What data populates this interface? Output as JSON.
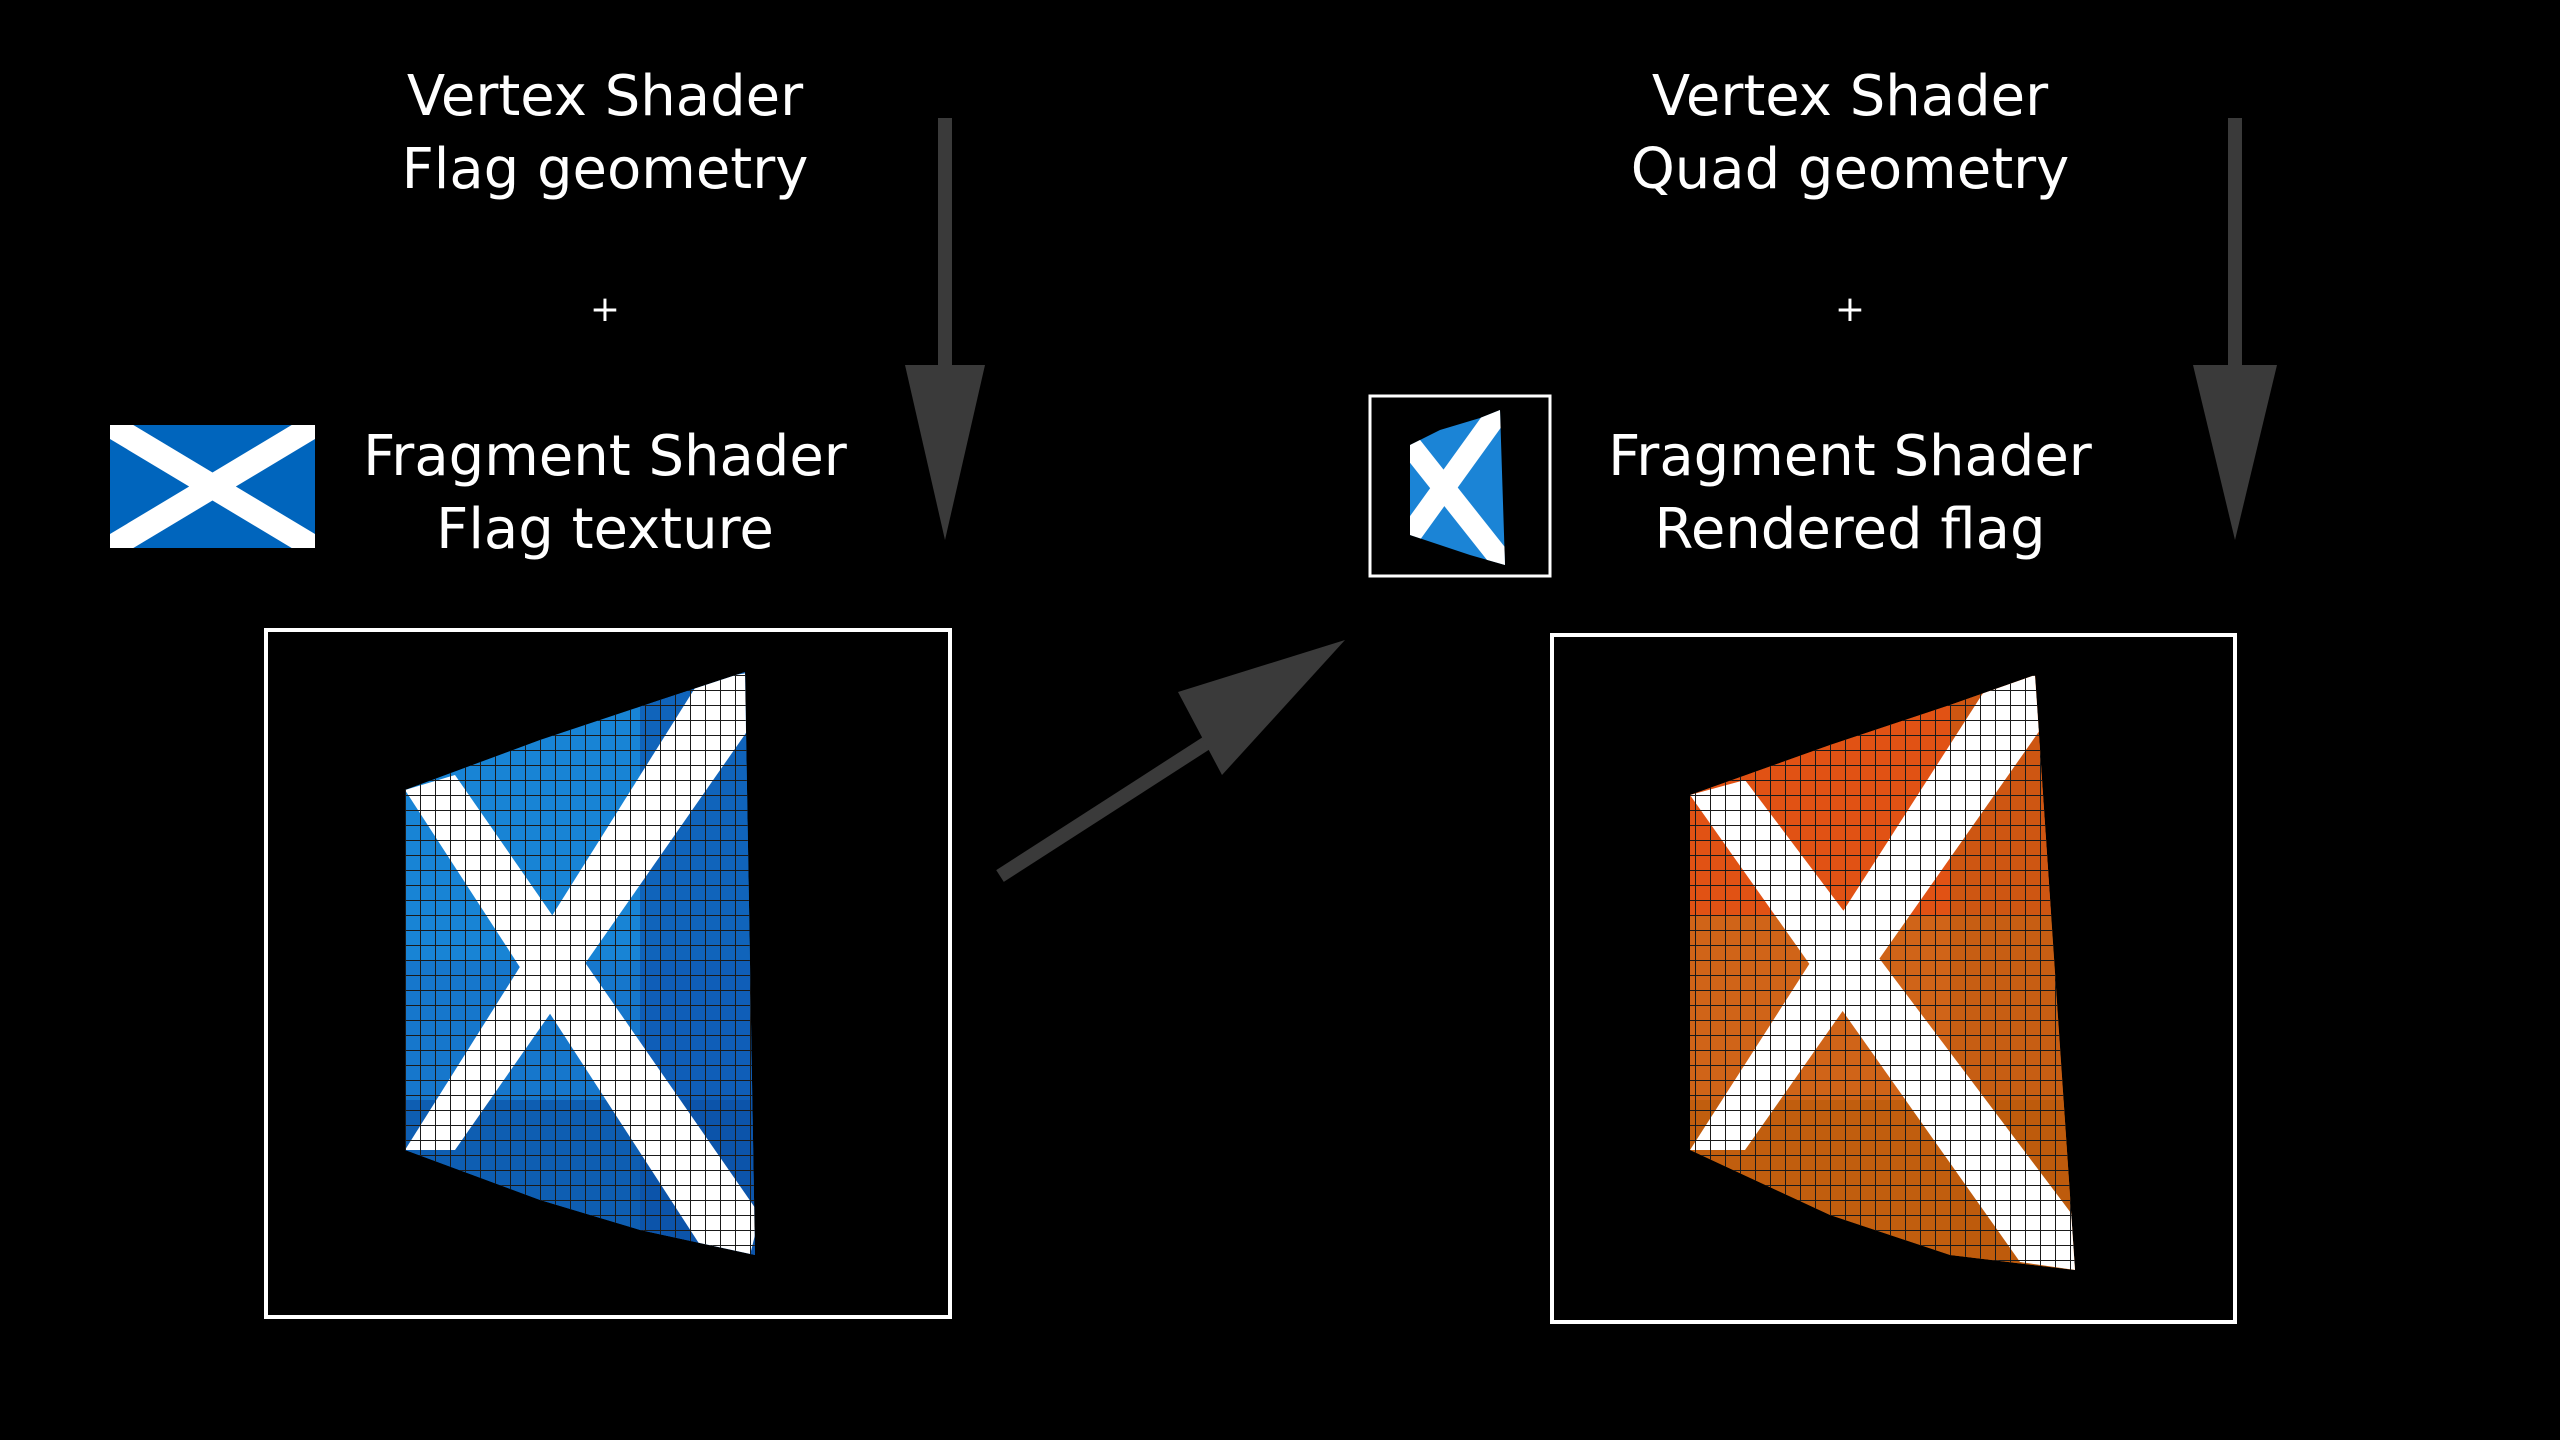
{
  "left_panel": {
    "vertex_title": "Vertex Shader",
    "vertex_subtitle": "Flag geometry",
    "plus": "+",
    "fragment_title": "Fragment Shader",
    "fragment_subtitle": "Flag texture"
  },
  "right_panel": {
    "vertex_title": "Vertex Shader",
    "vertex_subtitle": "Quad geometry",
    "plus": "+",
    "fragment_title": "Fragment Shader",
    "fragment_subtitle": "Rendered flag"
  },
  "colors": {
    "background": "#000000",
    "text": "#ffffff",
    "arrow": "#3a3a3a",
    "flag_blue": "#0065bd",
    "flag_white": "#ffffff",
    "render_blue": "#1b84d6",
    "render_orange": "#e06a1a",
    "grid": "#222222"
  },
  "icons": {
    "flag": "saltire-flag-icon",
    "thumbnail": "rendered-flag-thumbnail-icon"
  }
}
